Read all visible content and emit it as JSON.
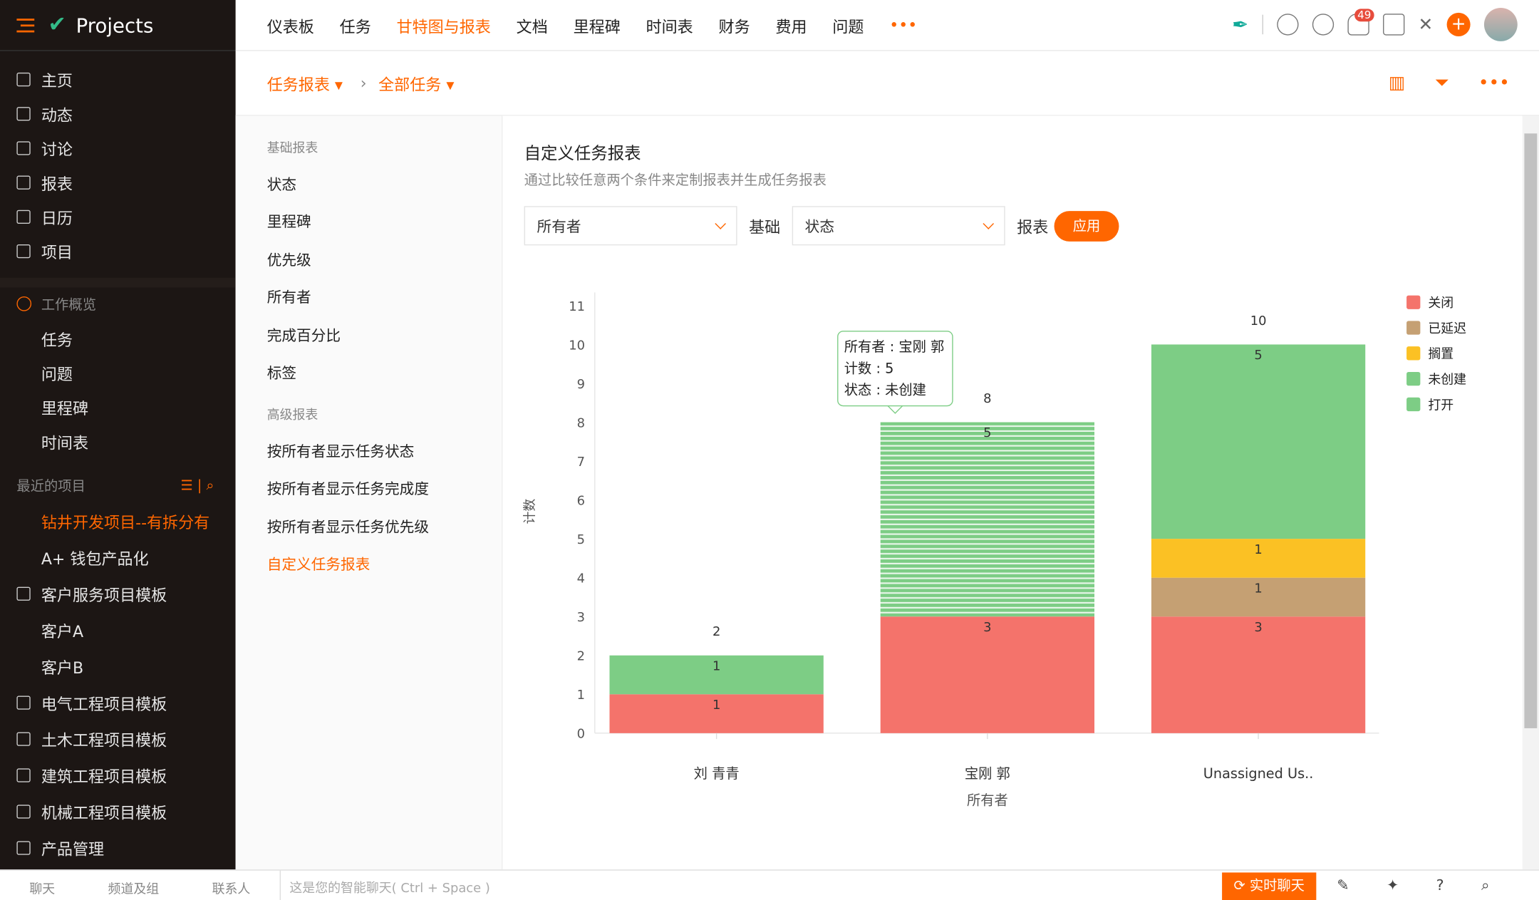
{
  "app": {
    "title": "Projects"
  },
  "sidebar": {
    "items": [
      {
        "label": "主页",
        "icon": "home-icon"
      },
      {
        "label": "动态",
        "icon": "feed-icon"
      },
      {
        "label": "讨论",
        "icon": "discuss-icon"
      },
      {
        "label": "报表",
        "icon": "report-icon"
      },
      {
        "label": "日历",
        "icon": "calendar-icon"
      },
      {
        "label": "项目",
        "icon": "project-icon"
      }
    ],
    "work_overview": {
      "label": "工作概览",
      "items": [
        "任务",
        "问题",
        "里程碑",
        "时间表"
      ]
    },
    "recent": {
      "label": "最近的项目",
      "items": [
        "钻井开发项目--有拆分有",
        "A+ 钱包产品化"
      ]
    },
    "templates": [
      "客户服务项目模板",
      "客户A",
      "客户B",
      "电气工程项目模板",
      "土木工程项目模板",
      "建筑工程项目模板",
      "机械工程项目模板",
      "产品管理"
    ]
  },
  "topnav": {
    "tabs": [
      "仪表板",
      "任务",
      "甘特图与报表",
      "文档",
      "里程碑",
      "时间表",
      "财务",
      "费用",
      "问题"
    ],
    "active": 2,
    "more": "•••",
    "notifications": "49"
  },
  "breadcrumb": {
    "first": "任务报表",
    "second": "全部任务"
  },
  "reports": {
    "basic_header": "基础报表",
    "basic": [
      "状态",
      "里程碑",
      "优先级",
      "所有者",
      "完成百分比",
      "标签"
    ],
    "advanced_header": "高级报表",
    "advanced": [
      "按所有者显示任务状态",
      "按所有者显示任务完成度",
      "按所有者显示任务优先级",
      "自定义任务报表"
    ]
  },
  "main": {
    "title": "自定义任务报表",
    "subtitle": "通过比较任意两个条件来定制报表并生成任务报表",
    "select1": "所有者",
    "basis_label": "基础",
    "select2": "状态",
    "report_label": "报表",
    "apply": "应用"
  },
  "tooltip": {
    "line1": "所有者 : 宝刚 郭",
    "line2": "计数 : 5",
    "line3": "状态 : 未创建"
  },
  "chart_data": {
    "type": "bar",
    "stacked": true,
    "categories": [
      "刘 青青",
      "宝刚 郭",
      "Unassigned Us.."
    ],
    "xlabel": "所有者",
    "ylabel": "计数",
    "ylim": [
      0,
      11
    ],
    "yticks": [
      0,
      1,
      2,
      3,
      4,
      5,
      6,
      7,
      8,
      9,
      10,
      11
    ],
    "totals": [
      2,
      8,
      10
    ],
    "series": [
      {
        "name": "关闭",
        "color": "#f4736b",
        "values": [
          1,
          3,
          3
        ]
      },
      {
        "name": "已延迟",
        "color": "#c5a073",
        "values": [
          0,
          0,
          1
        ]
      },
      {
        "name": "搁置",
        "color": "#fbc124",
        "values": [
          0,
          0,
          1
        ]
      },
      {
        "name": "未创建",
        "color": "#7dcd85",
        "values": [
          1,
          5,
          0
        ]
      },
      {
        "name": "打开",
        "color": "#7dcd85",
        "values": [
          0,
          0,
          5
        ]
      }
    ],
    "legend": "right"
  },
  "bottom": {
    "chat": "聊天",
    "channels": "频道及组",
    "contacts": "联系人",
    "placeholder": "这是您的智能聊天( Ctrl + Space )",
    "live": "实时聊天"
  }
}
